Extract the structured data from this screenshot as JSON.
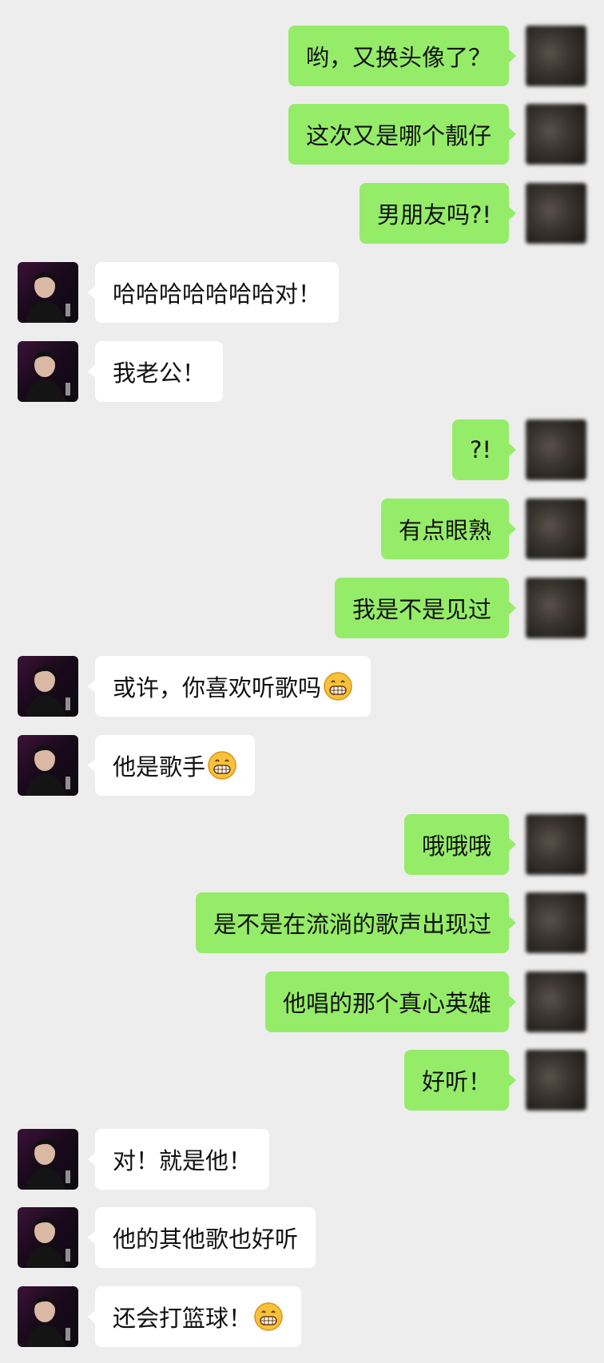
{
  "chat": {
    "messages": [
      {
        "side": "right",
        "text": "哟，又换头像了？",
        "emoji": false
      },
      {
        "side": "right",
        "text": "这次又是哪个靓仔",
        "emoji": false
      },
      {
        "side": "right",
        "text": "男朋友吗?!",
        "emoji": false
      },
      {
        "side": "left",
        "text": "哈哈哈哈哈哈哈对！",
        "emoji": false
      },
      {
        "side": "left",
        "text": "我老公！",
        "emoji": false
      },
      {
        "side": "right",
        "text": "?!",
        "emoji": false
      },
      {
        "side": "right",
        "text": "有点眼熟",
        "emoji": false
      },
      {
        "side": "right",
        "text": "我是不是见过",
        "emoji": false
      },
      {
        "side": "left",
        "text": "或许，你喜欢听歌吗",
        "emoji": true
      },
      {
        "side": "left",
        "text": "他是歌手",
        "emoji": true
      },
      {
        "side": "right",
        "text": "哦哦哦",
        "emoji": false
      },
      {
        "side": "right",
        "text": "是不是在流淌的歌声出现过",
        "emoji": false
      },
      {
        "side": "right",
        "text": "他唱的那个真心英雄",
        "emoji": false
      },
      {
        "side": "right",
        "text": "好听！",
        "emoji": false
      },
      {
        "side": "left",
        "text": "对！就是他！",
        "emoji": false
      },
      {
        "side": "left",
        "text": "他的其他歌也好听",
        "emoji": false
      },
      {
        "side": "left",
        "text": "还会打篮球！",
        "emoji": true
      }
    ]
  },
  "icons": {
    "self_avatar": "blurred-avatar-icon",
    "contact_avatar": "singer-portrait-avatar-icon",
    "emoji": "grinning-face-emoji-icon"
  },
  "colors": {
    "background": "#ededed",
    "outgoing_bubble": "#95ec69",
    "incoming_bubble": "#ffffff",
    "text": "#111111"
  }
}
